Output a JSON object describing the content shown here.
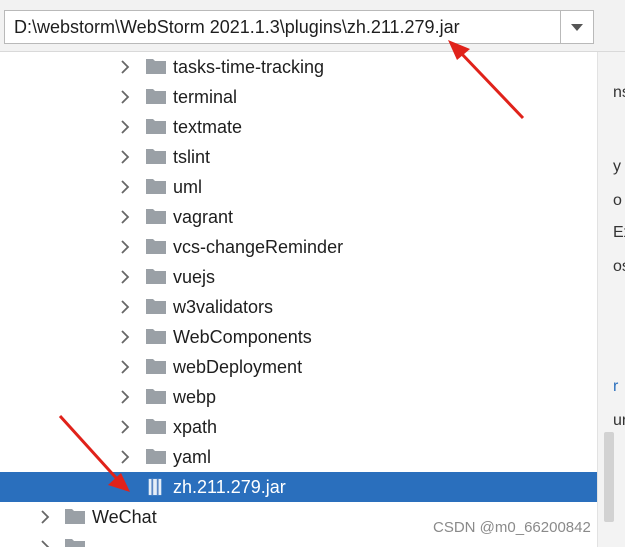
{
  "path_bar": {
    "value": "D:\\webstorm\\WebStorm 2021.1.3\\plugins\\zh.211.279.jar"
  },
  "tree": {
    "items": [
      {
        "label": "tasks-time-tracking",
        "type": "folder"
      },
      {
        "label": "terminal",
        "type": "folder"
      },
      {
        "label": "textmate",
        "type": "folder"
      },
      {
        "label": "tslint",
        "type": "folder"
      },
      {
        "label": "uml",
        "type": "folder"
      },
      {
        "label": "vagrant",
        "type": "folder"
      },
      {
        "label": "vcs-changeReminder",
        "type": "folder"
      },
      {
        "label": "vuejs",
        "type": "folder"
      },
      {
        "label": "w3validators",
        "type": "folder"
      },
      {
        "label": "WebComponents",
        "type": "folder"
      },
      {
        "label": "webDeployment",
        "type": "folder"
      },
      {
        "label": "webp",
        "type": "folder"
      },
      {
        "label": "xpath",
        "type": "folder"
      },
      {
        "label": "yaml",
        "type": "folder"
      },
      {
        "label": "zh.211.279.jar",
        "type": "jar",
        "selected": true
      },
      {
        "label": "WeChat",
        "type": "folder"
      }
    ]
  },
  "side_fragments": [
    "ns",
    "y",
    "o",
    "Ex",
    "os",
    "r",
    "ur"
  ],
  "watermark": "CSDN @m0_66200842",
  "colors": {
    "selection": "#2a6fbd",
    "folder": "#9aa0a6",
    "annotation_arrow": "#e0221a"
  }
}
